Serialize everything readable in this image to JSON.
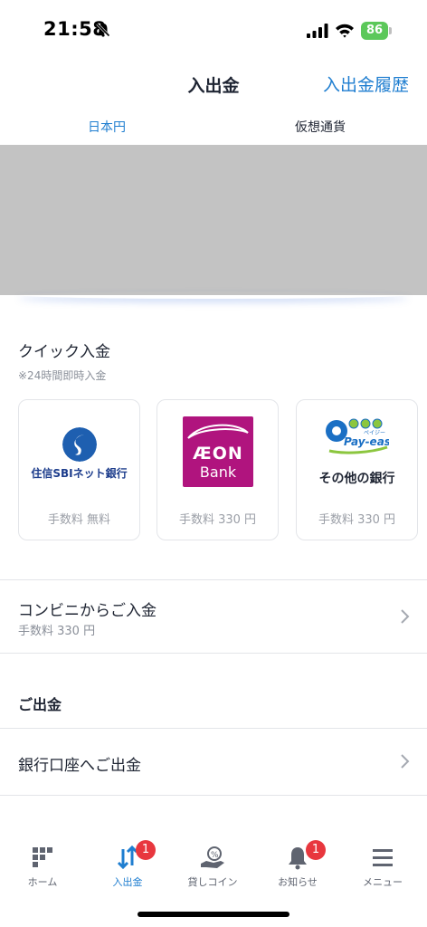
{
  "status": {
    "time": "21:58",
    "battery": "86"
  },
  "header": {
    "title": "入出金",
    "history": "入出金履歴"
  },
  "tabs": [
    {
      "label": "日本円"
    },
    {
      "label": "仮想通貨"
    }
  ],
  "quick": {
    "title": "クイック入金",
    "subtitle": "※24時間即時入金",
    "cards": [
      {
        "name": "住信SBIネット銀行",
        "fee": "手数料 無料"
      },
      {
        "logo_line1": "ÆON",
        "logo_line2": "Bank",
        "fee": "手数料 330 円"
      },
      {
        "name": "その他の銀行",
        "logo_text": "Pay-easy",
        "logo_small": "ペイジー",
        "fee": "手数料 330 円"
      }
    ]
  },
  "convenience": {
    "title": "コンビニからご入金",
    "fee": "手数料 330 円"
  },
  "withdraw": {
    "heading": "ご出金",
    "bank_title": "銀行口座へご出金"
  },
  "nav": [
    {
      "label": "ホーム",
      "icon": "home-grid-icon"
    },
    {
      "label": "入出金",
      "icon": "transfer-arrows-icon",
      "badge": "1"
    },
    {
      "label": "貸しコイン",
      "icon": "lend-coin-icon"
    },
    {
      "label": "お知らせ",
      "icon": "bell-icon",
      "badge": "1"
    },
    {
      "label": "メニュー",
      "icon": "menu-icon"
    }
  ],
  "colors": {
    "accent": "#1f7ed0",
    "badge": "#e8373e",
    "aeon": "#b0147e",
    "battery": "#5cc85a"
  }
}
